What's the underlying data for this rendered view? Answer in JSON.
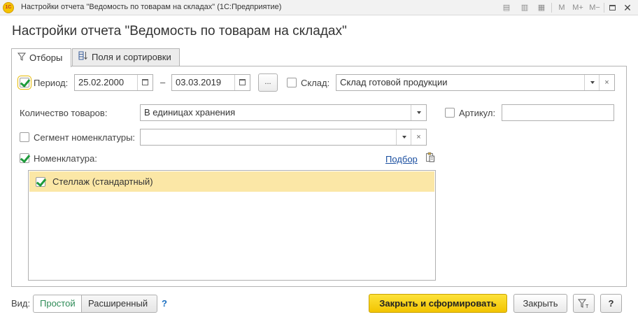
{
  "window": {
    "app_logo": "1С",
    "title": "Настройки отчета \"Ведомость по товарам на складах\"  (1С:Предприятие)",
    "controls": {
      "m": "M",
      "m_plus": "M+",
      "m_minus": "M−"
    }
  },
  "form": {
    "title": "Настройки отчета \"Ведомость по товарам на складах\""
  },
  "tabs": [
    {
      "label": "Отборы",
      "icon": "filter-icon",
      "active": true
    },
    {
      "label": "Поля и сортировки",
      "icon": "fields-sort-icon",
      "active": false
    }
  ],
  "filters": {
    "period": {
      "checked": true,
      "label": "Период:",
      "date_from": "25.02.2000",
      "dash": "–",
      "date_to": "03.03.2019",
      "dots_label": "..."
    },
    "warehouse": {
      "checked": false,
      "label": "Склад:",
      "value": "Склад готовой продукции"
    },
    "quantity": {
      "label": "Количество товаров:",
      "value": "В единицах хранения"
    },
    "article": {
      "checked": false,
      "label": "Артикул:",
      "value": ""
    },
    "segment": {
      "checked": false,
      "label": "Сегмент номенклатуры:",
      "value": ""
    },
    "nomenclature": {
      "checked": true,
      "label": "Номенклатура:",
      "pick_link": "Подбор",
      "items": [
        {
          "checked": true,
          "label": "Стеллаж (стандартный)"
        }
      ]
    }
  },
  "footer": {
    "view_label": "Вид:",
    "simple": "Простой",
    "advanced": "Расширенный",
    "help": "?",
    "close_and_generate": "Закрыть и сформировать",
    "close": "Закрыть",
    "filter_btn_icon": "filter-t-icon",
    "help_btn": "?"
  }
}
